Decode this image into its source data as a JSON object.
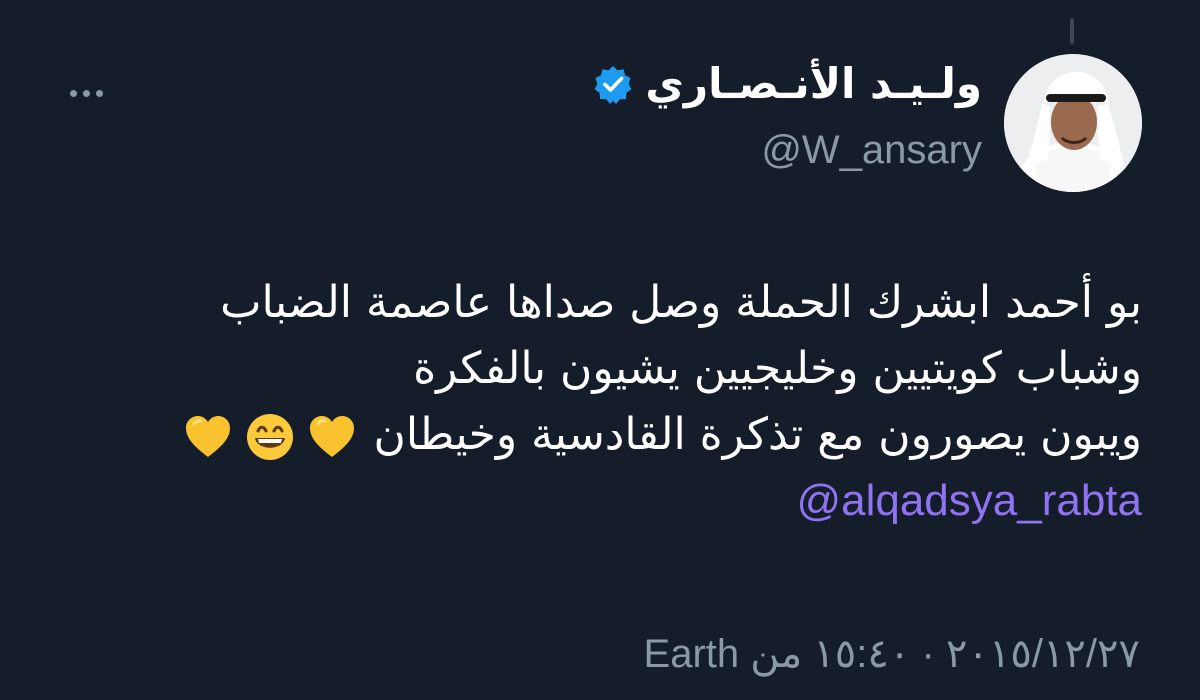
{
  "author": {
    "display_name": "ولـيـد الأنـصـاري",
    "handle": "@W_ansary",
    "verified": true
  },
  "icons": {
    "verified": "verified-badge-icon",
    "more": "more-horizontal-icon",
    "emoji_1": "yellow-heart-emoji",
    "emoji_2": "grinning-face-emoji",
    "emoji_3": "yellow-heart-emoji"
  },
  "tweet": {
    "lines": [
      "بو أحمد ابشرك الحملة وصل صداها عاصمة الضباب",
      "وشباب كويتيين وخليجيين يشيون بالفكرة",
      "ويبون يصورون مع تذكرة القادسية وخيطان"
    ],
    "mention": "@alqadsya_rabta"
  },
  "meta": {
    "date": "٢٠١٥/١٢/٢٧",
    "separator": "·",
    "time": "١٥:٤٠",
    "source_prefix": "من",
    "source": "Earth"
  },
  "colors": {
    "background": "#151d2a",
    "text_primary": "#ffffff",
    "text_secondary": "#8b98a5",
    "mention": "#8f73f2",
    "verified": "#1d9bf0",
    "heart": "#f9c22e"
  }
}
